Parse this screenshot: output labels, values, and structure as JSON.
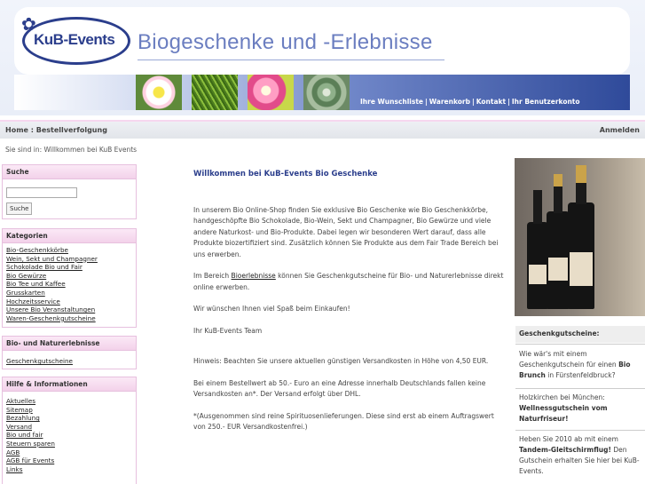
{
  "header": {
    "logo_text": "KuB-Events",
    "site_title": "Biogeschenke und -Erlebnisse",
    "nav": [
      "Ihre Wunschliste",
      "Warenkorb",
      "Kontakt",
      "Ihr Benutzerkonto"
    ]
  },
  "crumbs": {
    "home": "Home",
    "sep": ":",
    "order": "Bestellverfolgung",
    "login": "Anmelden",
    "you_are": "Sie sind in: Willkommen bei KuB Events"
  },
  "sidebar": {
    "search": {
      "title": "Suche",
      "button": "Suche"
    },
    "categories": {
      "title": "Kategorien",
      "items": [
        "Bio-Geschenkkörbe",
        "Wein, Sekt und Champagner",
        "Schokolade Bio und Fair",
        "Bio Gewürze",
        "Bio Tee und Kaffee",
        "Grusskarten",
        "Hochzeitsservice",
        "Unsere Bio Veranstaltungen",
        "Waren-Geschenkgutscheine"
      ]
    },
    "bio": {
      "title": "Bio- und Naturerlebnisse",
      "items": [
        "Geschenkgutscheine"
      ]
    },
    "help": {
      "title": "Hilfe & Informationen",
      "items": [
        "Aktuelles",
        "Sitemap",
        "Bezahlung",
        "Versand",
        "Bio und fair",
        "Steuern sparen",
        "AGB",
        "AGB für Events",
        "Links"
      ]
    }
  },
  "main": {
    "heading": "Willkommen bei KuB-Events Bio Geschenke",
    "p1": "In unserem Bio Online-Shop finden Sie exklusive Bio Geschenke wie Bio Geschenkkörbe, handgeschöpfte Bio Schokolade, Bio-Wein, Sekt und Champagner, Bio Gewürze und viele andere Naturkost- und Bio-Produkte. Dabei legen wir besonderen Wert darauf, dass alle Produkte biozertifiziert sind. Zusätzlich können Sie Produkte aus dem Fair Trade Bereich bei uns erwerben.",
    "p2_a": "Im Bereich ",
    "p2_link": "Bioerlebnisse",
    "p2_b": " können Sie Geschenkgutscheine für Bio- und Naturerlebnisse direkt online erwerben.",
    "p3": "Wir wünschen Ihnen viel Spaß beim Einkaufen!",
    "p4": "Ihr KuB-Events Team",
    "p5": "Hinweis: Beachten Sie unsere aktuellen günstigen Versandkosten in Höhe von 4,50 EUR.",
    "p6": "Bei einem Bestellwert ab 50.- Euro an eine Adresse innerhalb Deutschlands fallen keine Versandkosten an*. Der Versand erfolgt über DHL.",
    "p7": "*(Ausgenommen sind reine Spirituosenlieferungen. Diese sind erst ab einem Auftragswert von 250.- EUR Versandkostenfrei.)"
  },
  "right": {
    "heading": "Geschenkgutscheine:",
    "g1_a": "Wie wär's mit einem Geschenkgutschein für einen ",
    "g1_b": "Bio Brunch",
    "g1_c": " in Fürstenfeldbruck?",
    "g2_a": "Holzkirchen bei München: ",
    "g2_b": "Wellnessgutschein vom Naturfriseur!",
    "g3_a": "Heben Sie 2010 ab mit einem ",
    "g3_b": "Tandem-Gleitschirmflug!",
    "g3_c": " Den Gutschein erhalten Sie hier bei KuB-Events."
  }
}
